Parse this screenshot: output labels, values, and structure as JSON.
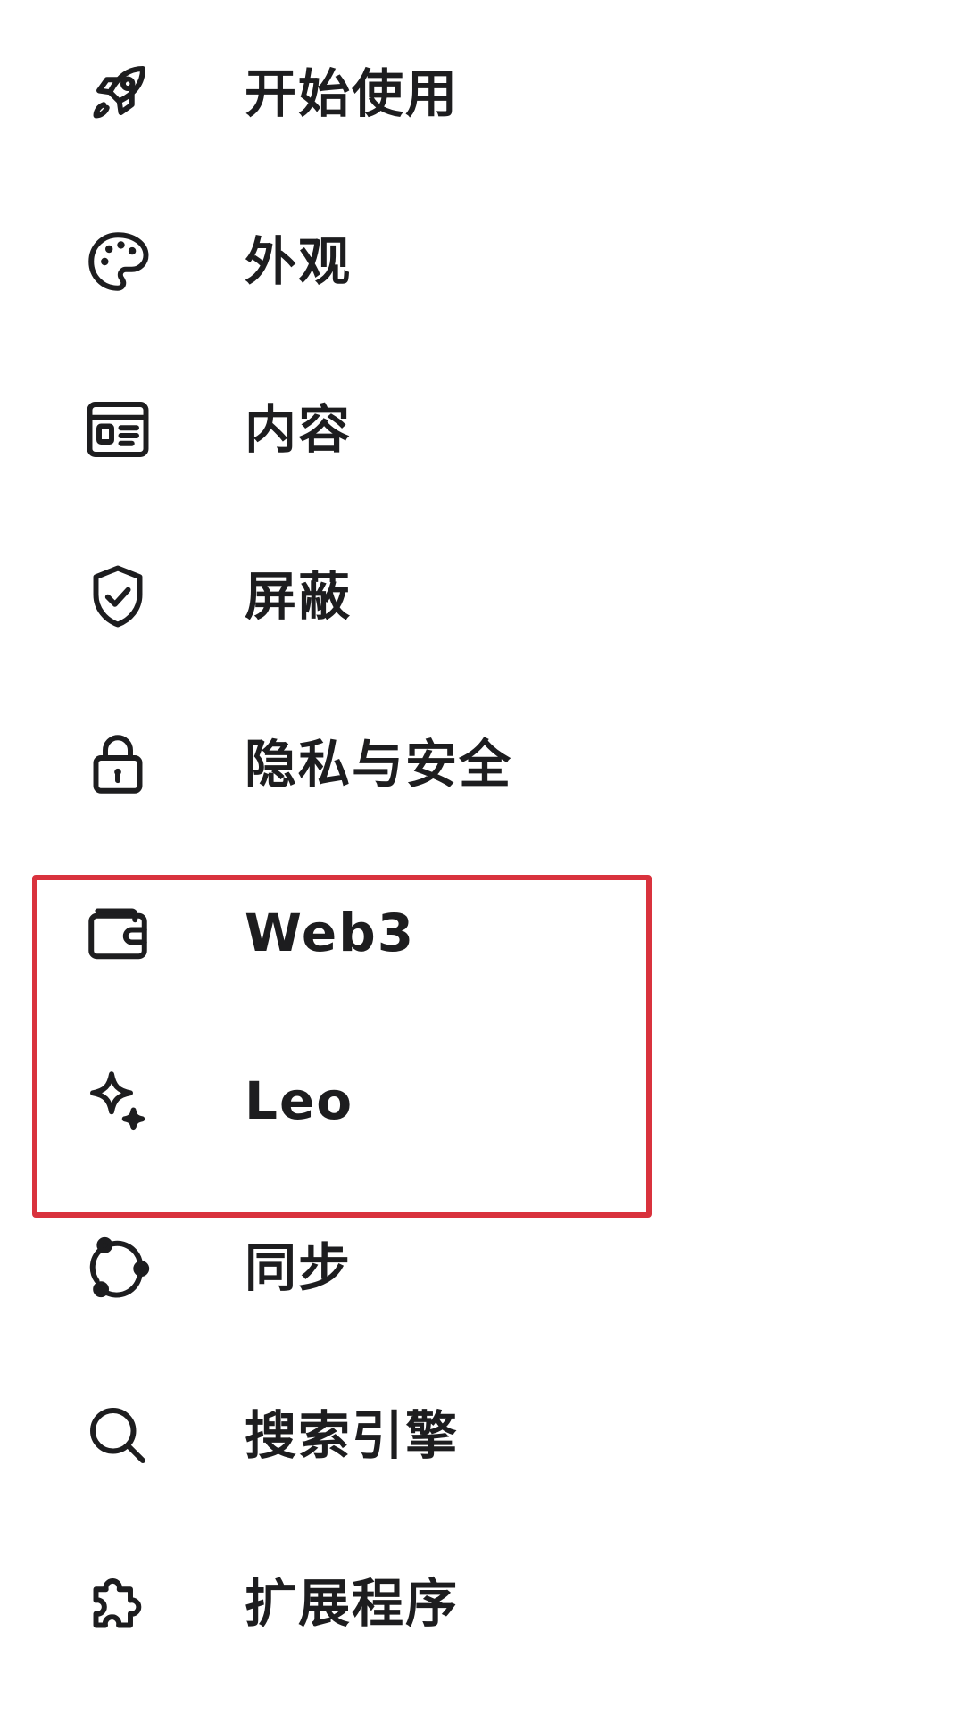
{
  "menu": {
    "items": [
      {
        "label": "开始使用",
        "icon": "rocket-icon"
      },
      {
        "label": "外观",
        "icon": "palette-icon"
      },
      {
        "label": "内容",
        "icon": "content-icon"
      },
      {
        "label": "屏蔽",
        "icon": "shield-check-icon"
      },
      {
        "label": "隐私与安全",
        "icon": "lock-icon"
      },
      {
        "label": "Web3",
        "icon": "wallet-icon"
      },
      {
        "label": "Leo",
        "icon": "sparkle-icon"
      },
      {
        "label": "同步",
        "icon": "sync-icon"
      },
      {
        "label": "搜索引擎",
        "icon": "search-icon"
      },
      {
        "label": "扩展程序",
        "icon": "puzzle-icon"
      }
    ]
  },
  "colors": {
    "text": "#1d1d1f",
    "highlight_border": "#d9323d",
    "background": "#ffffff"
  }
}
